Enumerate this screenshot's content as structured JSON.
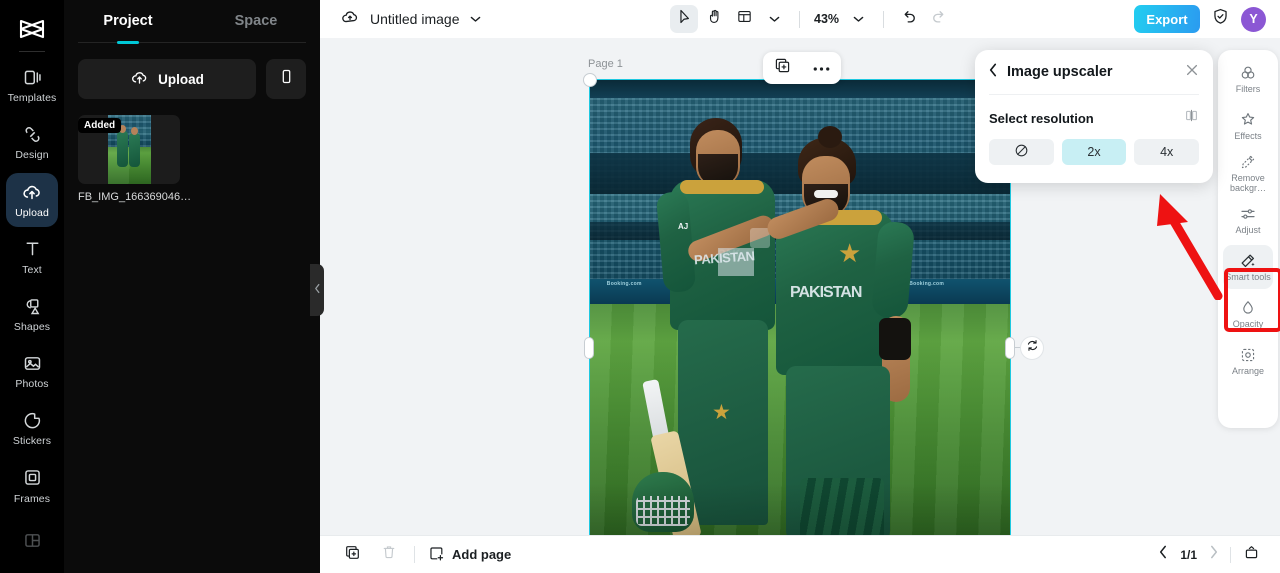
{
  "rail": {
    "logo_icon": "capcut-logo-icon",
    "items": [
      {
        "label": "Templates",
        "icon": "templates-icon",
        "active": false
      },
      {
        "label": "Design",
        "icon": "design-icon",
        "active": false
      },
      {
        "label": "Upload",
        "icon": "upload-cloud-icon",
        "active": true
      },
      {
        "label": "Text",
        "icon": "text-icon",
        "active": false
      },
      {
        "label": "Shapes",
        "icon": "shapes-icon",
        "active": false
      },
      {
        "label": "Photos",
        "icon": "photos-icon",
        "active": false
      },
      {
        "label": "Stickers",
        "icon": "stickers-icon",
        "active": false
      },
      {
        "label": "Frames",
        "icon": "frames-icon",
        "active": false
      },
      {
        "label": "",
        "icon": "layout-grid-icon",
        "active": false
      }
    ]
  },
  "panel": {
    "tabs": [
      {
        "label": "Project",
        "active": true
      },
      {
        "label": "Space",
        "active": false
      }
    ],
    "upload_label": "Upload",
    "upload_icon": "upload-cloud-icon",
    "device_icon": "mobile-device-icon",
    "assets": [
      {
        "badge": "Added",
        "name": "FB_IMG_166369046…"
      }
    ],
    "collapse_icon": "chevron-left-icon",
    "accent": "#00c8d7"
  },
  "topbar": {
    "cloud_icon": "cloud-sync-icon",
    "doc_title": "Untitled image",
    "doc_caret_icon": "chevron-down-icon",
    "tools": [
      {
        "icon": "cursor-select-icon",
        "selected": true
      },
      {
        "icon": "hand-pan-icon",
        "selected": false
      },
      {
        "icon": "layout-panels-icon",
        "selected": false
      },
      {
        "icon": "chevron-down-icon",
        "selected": false
      }
    ],
    "zoom": "43%",
    "zoom_caret_icon": "chevron-down-icon",
    "undo_icon": "undo-icon",
    "redo_icon": "redo-icon",
    "export_label": "Export",
    "export_color": "#2bb4ef",
    "shield_icon": "shield-check-icon",
    "avatar_initial": "Y",
    "avatar_color": "#8b57d4"
  },
  "canvas": {
    "page_label": "Page 1",
    "float_tools": [
      {
        "icon": "duplicate-icon"
      },
      {
        "icon": "more-options-icon"
      }
    ],
    "rotate_icon": "rotate-icon",
    "selection_color": "#1ec8e0",
    "photo": {
      "alt": "Two cricket players in green Pakistan jerseys embracing on a stadium field",
      "board_texts": [
        "Booking.com",
        "Booking.com",
        "Booking.com"
      ],
      "jersey_text_1": "PAKISTAN",
      "jersey_text_2": "PAKISTAN",
      "sleeve_text": "AJ"
    }
  },
  "bottombar": {
    "duplicate_icon": "duplicate-page-icon",
    "delete_icon": "trash-icon",
    "add_page_label": "Add page",
    "add_page_icon": "add-page-icon",
    "prev_icon": "chevron-left-icon",
    "page_count": "1/1",
    "next_icon": "chevron-right-icon",
    "timeline_icon": "timeline-icon"
  },
  "upscaler": {
    "back_icon": "chevron-left-icon",
    "title": "Image upscaler",
    "close_icon": "close-icon",
    "subtitle": "Select resolution",
    "compare_icon": "compare-split-icon",
    "options": [
      {
        "label": "",
        "icon": "none-disabled-icon",
        "active": false
      },
      {
        "label": "2x",
        "icon": "",
        "active": true
      },
      {
        "label": "4x",
        "icon": "",
        "active": false
      }
    ],
    "active_color": "#c8eff4"
  },
  "rightrail": {
    "items": [
      {
        "label": "Filters",
        "icon": "filters-icon",
        "selected": false
      },
      {
        "label": "Effects",
        "icon": "effects-sparkle-icon",
        "selected": false
      },
      {
        "label": "Remove backgr…",
        "icon": "remove-background-icon",
        "selected": false
      },
      {
        "label": "Adjust",
        "icon": "adjust-sliders-icon",
        "selected": false
      },
      {
        "label": "Smart tools",
        "icon": "smart-tools-wand-icon",
        "selected": true
      },
      {
        "label": "Opacity",
        "icon": "opacity-drop-icon",
        "selected": false
      },
      {
        "label": "Arrange",
        "icon": "arrange-icon",
        "selected": false
      }
    ],
    "highlight_color": "#ee1212"
  },
  "annotation": {
    "arrow_color": "#ee1212",
    "arrow_icon": "pointer-arrow-annotation"
  }
}
